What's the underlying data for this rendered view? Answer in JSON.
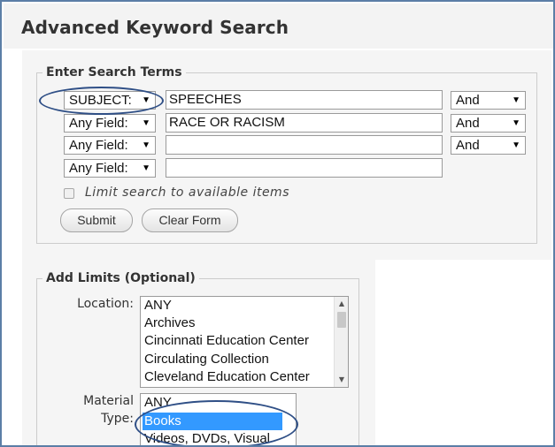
{
  "page": {
    "title": "Advanced Keyword Search"
  },
  "search_terms": {
    "legend": "Enter Search Terms",
    "rows": [
      {
        "field": "SUBJECT:",
        "term": "SPEECHES",
        "operator": "And"
      },
      {
        "field": "Any Field:",
        "term": "RACE OR RACISM",
        "operator": "And"
      },
      {
        "field": "Any Field:",
        "term": "",
        "operator": "And"
      },
      {
        "field": "Any Field:",
        "term": ""
      }
    ],
    "limit_label": "Limit search to available items",
    "limit_checked": false,
    "submit_label": "Submit",
    "clear_label": "Clear Form"
  },
  "limits": {
    "legend": "Add Limits (Optional)",
    "location": {
      "label": "Location:",
      "options": [
        "ANY",
        "Archives",
        "Cincinnati Education Center",
        "Circulating Collection",
        "Cleveland Education Center"
      ]
    },
    "material_type": {
      "label_line1": "Material",
      "label_line2": "Type:",
      "options": [
        "ANY",
        "Books",
        "Videos, DVDs, Visual"
      ],
      "selected": "Books"
    }
  },
  "colors": {
    "accent_border": "#5b7ea6",
    "callout": "#2f4f86",
    "selection": "#3399ff"
  },
  "icons": {
    "dropdown": "triangle-down",
    "scroll_up": "triangle-up",
    "scroll_down": "triangle-down"
  }
}
